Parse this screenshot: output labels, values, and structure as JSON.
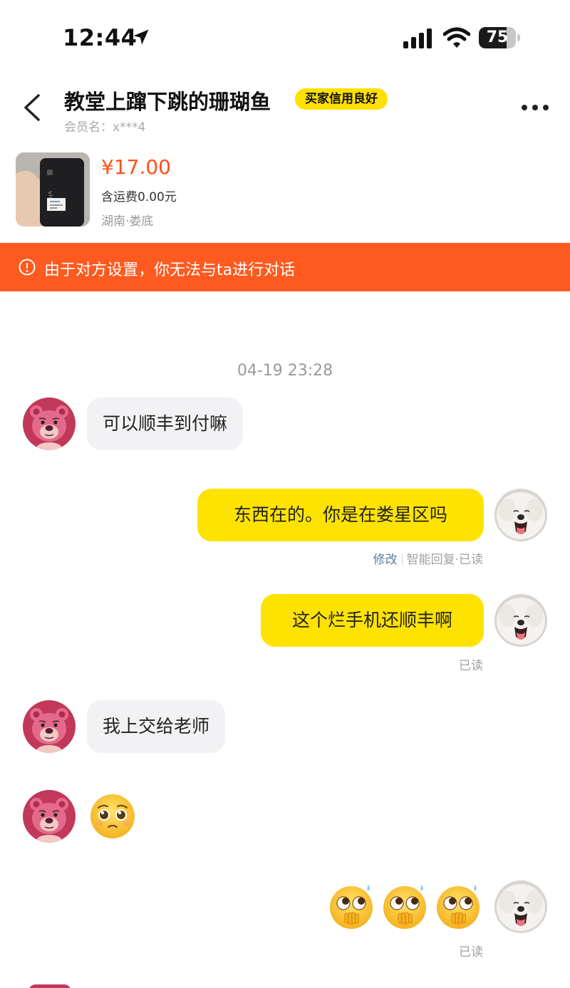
{
  "status_bar": {
    "time": "12:44",
    "battery": "75",
    "battery_level": 0.75
  },
  "header": {
    "title": "教堂上蹿下跳的珊瑚鱼",
    "badge": "买家信用良好",
    "member_label": "会员名：",
    "member_name": "x***4"
  },
  "product": {
    "price": "¥17.00",
    "shipping": "含运费0.00元",
    "location": "湖南·娄底"
  },
  "banner": {
    "text": "由于对方设置，你无法与ta进行对话"
  },
  "chat": {
    "timestamp": "04-19 23:28",
    "messages": [
      {
        "side": "in",
        "text": "可以顺丰到付嘛"
      },
      {
        "side": "out",
        "text": "东西在的。你是在娄星区吗",
        "edit": "修改",
        "status": "智能回复·已读"
      },
      {
        "side": "out",
        "text": "这个烂手机还顺丰啊",
        "status": "已读"
      },
      {
        "side": "in",
        "text": "我上交给老师"
      },
      {
        "side": "in",
        "emoji": "pleading-face"
      },
      {
        "side": "out",
        "emoji": "hand-over-mouth-face",
        "count": 3,
        "status": "已读"
      }
    ]
  },
  "colors": {
    "accent_yellow": "#ffe300",
    "banner_orange": "#ff5a1f",
    "price_orange": "#ff4f1a",
    "incoming_bubble": "#f2f2f4"
  },
  "icons": [
    "location-arrow-icon",
    "signal-icon",
    "wifi-icon",
    "back-icon",
    "more-icon",
    "alert-icon"
  ]
}
